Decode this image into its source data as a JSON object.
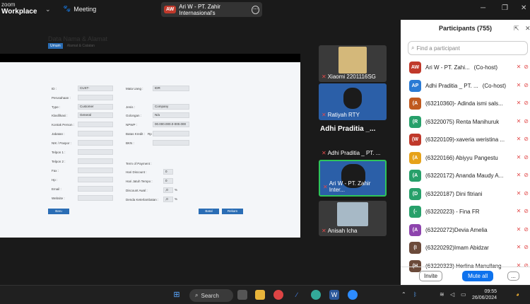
{
  "app": {
    "logo_line1": "zoom",
    "logo_line2": "Workplace",
    "meeting_label": "Meeting",
    "share_badge": "AW",
    "share_title": "Ari W - PT. Zahir Internasional's"
  },
  "form": {
    "title": "Data Nama & Alamat",
    "tabs": [
      "Umum",
      "Alamat & Catatan"
    ],
    "labels_left": [
      "ID :",
      "Perusahaan :",
      "Type :",
      "Klasifikasi :",
      "Kontak Person :",
      "Jabatan :",
      "NIK / Paspor :",
      "Telpon 1 :",
      "Telpon 2 :",
      "Fax :",
      "Hp :",
      "Email :",
      "Website :"
    ],
    "labels_right": [
      "Mata Uang :",
      "Jenis :",
      "Golongan :",
      "NPWP :",
      "Batas Kredit :",
      "BKN :",
      "Term of Payment :",
      "Hari Discount :",
      "Hari Jatuh Tempo :",
      "Discount Awal :",
      "Denda Keterlambatan :"
    ],
    "values": {
      "id": "CUST-",
      "type": "Customer",
      "klasifikasi": "General",
      "mata_uang": "IDR",
      "jenis": "Company",
      "golongan": "N/a",
      "npwp": "00.000.000.0-000.000",
      "batas_kredit": "Rp",
      "hari_discount": "0",
      "hari_jatuh_tempo": "0",
      "discount_awal": ",0",
      "denda": ",0",
      "pct": "%"
    },
    "buttons": {
      "baru": "Baru",
      "batal": "Batal",
      "rekam": "Rekam"
    }
  },
  "tiles": [
    {
      "name": "Xiaomi 2201116SG"
    },
    {
      "name": "Ratiyah RTY"
    },
    {
      "big": "Adhi Praditia _...",
      "name": "Adhi Praditia _ PT. ..."
    },
    {
      "name": "Ari W - PT. Zahir Inter..."
    },
    {
      "name": "Anisah Icha"
    }
  ],
  "participants": {
    "header": "Participants (755)",
    "search_placeholder": "Find a participant",
    "list": [
      {
        "initials": "AW",
        "color": "#c0392b",
        "name": "Ari W - PT. Zahi...",
        "role": "(Co-host)"
      },
      {
        "initials": "AP",
        "color": "#2a7bd4",
        "name": "Adhi Praditia _ PT. ...",
        "role": "(Co-host)"
      },
      {
        "initials": "(A",
        "color": "#c05a1f",
        "name": "(63210360)- Adinda ismi sals...",
        "role": ""
      },
      {
        "initials": "(R",
        "color": "#27a06a",
        "name": "(63220075) Renta Manihuruk",
        "role": ""
      },
      {
        "initials": "(W",
        "color": "#c0392b",
        "name": "(63220109)-xaveria weristina ...",
        "role": ""
      },
      {
        "initials": "(A",
        "color": "#e6a21a",
        "name": "(63220166) Abiyyu Pangestu",
        "role": ""
      },
      {
        "initials": "(A",
        "color": "#27a06a",
        "name": "(63220172) Ananda Maudy A...",
        "role": ""
      },
      {
        "initials": "(D",
        "color": "#27a06a",
        "name": "(63220187) Dini fitriani",
        "role": ""
      },
      {
        "initials": "(-",
        "color": "#27a06a",
        "name": "(63220223) - Fina FR",
        "role": ""
      },
      {
        "initials": "(A",
        "color": "#8e44ad",
        "name": "(63220272)Devia Amelia",
        "role": ""
      },
      {
        "initials": "(I",
        "color": "#6b4a3a",
        "name": "(63220292)Imam Abidzar",
        "role": ""
      },
      {
        "initials": "(H",
        "color": "#6b4a3a",
        "name": "(63220323) Herlina Manullang",
        "role": ""
      }
    ],
    "invite": "Invite",
    "mute_all": "Mute all",
    "more": "..."
  },
  "taskbar": {
    "search": "Search",
    "time": "09:55",
    "date": "26/06/2024"
  }
}
